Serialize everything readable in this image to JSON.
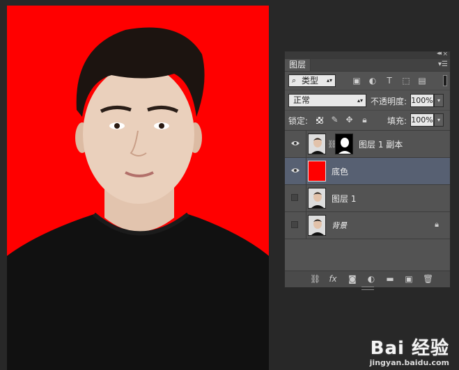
{
  "canvas": {
    "background_color": "#ff0000"
  },
  "panel": {
    "tab_label": "图层",
    "filter": {
      "selected": "类型"
    },
    "blend_mode": "正常",
    "opacity_label": "不透明度:",
    "opacity_value": "100%",
    "lock_label": "锁定:",
    "fill_label": "填充:",
    "fill_value": "100%",
    "layers": [
      {
        "name": "图层 1 副本",
        "visible": true,
        "selected": false,
        "has_mask": true,
        "locked": false
      },
      {
        "name": "底色",
        "visible": true,
        "selected": true,
        "has_mask": false,
        "locked": false
      },
      {
        "name": "图层 1",
        "visible": false,
        "selected": false,
        "has_mask": false,
        "locked": false
      },
      {
        "name": "背景",
        "visible": false,
        "selected": false,
        "has_mask": false,
        "locked": true
      }
    ],
    "colors": {
      "selected_row": "#576072",
      "panel_bg": "#535353",
      "fill_layer_color": "#ff0000"
    }
  },
  "watermark": {
    "logo": "Bai 经验",
    "url": "jingyan.baidu.com"
  }
}
